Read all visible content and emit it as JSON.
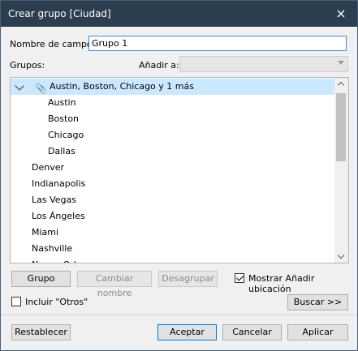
{
  "window": {
    "title": "Crear grupo [Ciudad]",
    "close_icon": "×"
  },
  "field_name": {
    "label": "Nombre de campo:",
    "value": "Grupo 1"
  },
  "groups_label": "Grupos:",
  "add_to": {
    "label": "Añadir a:",
    "value": ""
  },
  "tree": {
    "group_label": "Austin, Boston, Chicago y 1 más",
    "group_children": [
      "Austin",
      "Boston",
      "Chicago",
      "Dallas"
    ],
    "items": [
      "Denver",
      "Indianapolis",
      "Las Vegas",
      "Los Ángeles",
      "Miami",
      "Nashville",
      "Nueva Orleans"
    ]
  },
  "buttons": {
    "group": "Grupo",
    "rename": "Cambiar nombre",
    "ungroup": "Desagrupar",
    "find": "Buscar >>",
    "reset": "Restablecer",
    "ok": "Aceptar",
    "cancel": "Cancelar",
    "apply": "Aplicar"
  },
  "show_add_location": {
    "label": "Mostrar Añadir ubicación",
    "checked": true
  },
  "include_others": {
    "label": "Incluir \"Otros\"",
    "checked": false
  }
}
